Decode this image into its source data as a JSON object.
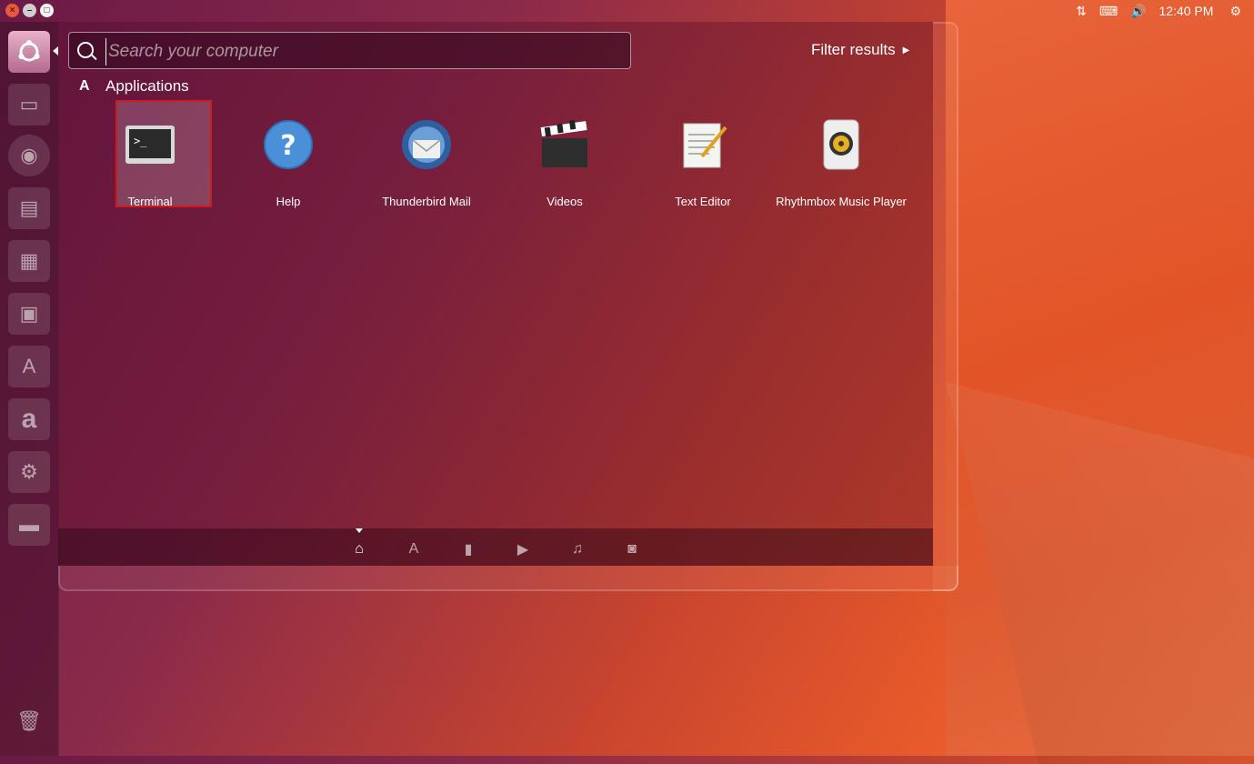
{
  "panel": {
    "time": "12:40 PM"
  },
  "search": {
    "placeholder": "Search your computer"
  },
  "filter_label": "Filter results",
  "category": {
    "title": "Applications"
  },
  "apps": [
    {
      "label": "Terminal"
    },
    {
      "label": "Help"
    },
    {
      "label": "Thunderbird Mail"
    },
    {
      "label": "Videos"
    },
    {
      "label": "Text Editor"
    },
    {
      "label": "Rhythmbox Music Player"
    }
  ],
  "colors": {
    "accent": "#e95420",
    "selection_border": "#d01a20"
  }
}
